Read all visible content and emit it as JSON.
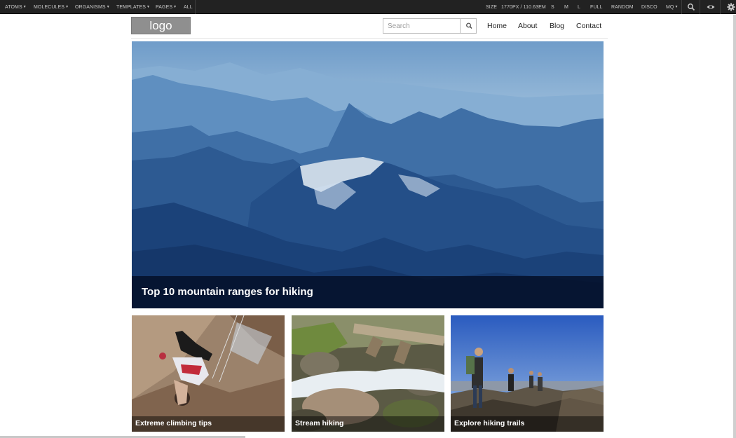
{
  "toolbar": {
    "menus": [
      "ATOMS",
      "MOLECULES",
      "ORGANISMS",
      "TEMPLATES",
      "PAGES"
    ],
    "all_label": "ALL",
    "size_label": "SIZE",
    "size_value": "1770PX / 110.63EM",
    "sizes": [
      "S",
      "M",
      "L",
      "FULL",
      "RANDOM",
      "DISCO"
    ],
    "mq_label": "MQ",
    "icons": [
      "search-icon",
      "eye-icon",
      "gear-icon"
    ]
  },
  "header": {
    "logo_text": "logo",
    "search_placeholder": "Search",
    "nav": [
      "Home",
      "About",
      "Blog",
      "Contact"
    ]
  },
  "hero": {
    "title": "Top 10 mountain ranges for hiking"
  },
  "cards": [
    {
      "title": "Extreme climbing tips"
    },
    {
      "title": "Stream hiking"
    },
    {
      "title": "Explore hiking trails"
    }
  ],
  "colors": {
    "toolbar_bg": "#222222",
    "hero_caption_bg": "#040e26",
    "logo_bg": "#8f8f8f"
  }
}
